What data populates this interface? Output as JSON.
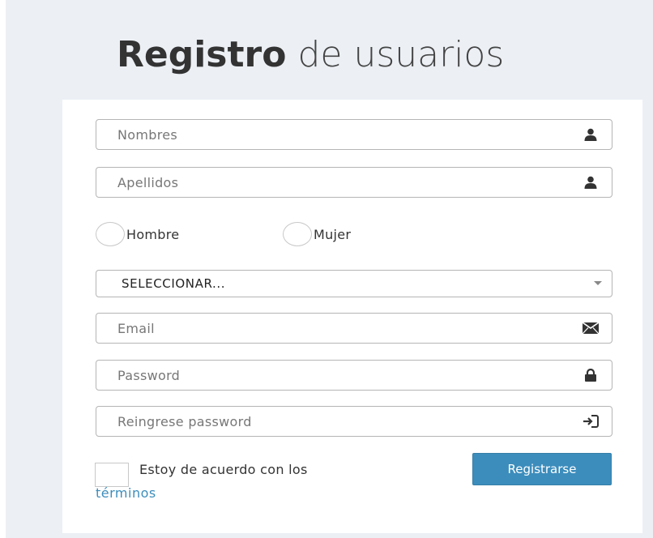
{
  "title": {
    "bold": "Registro",
    "rest": "de usuarios"
  },
  "form": {
    "nombres_placeholder": "Nombres",
    "apellidos_placeholder": "Apellidos",
    "gender_options": [
      "Hombre",
      "Mujer"
    ],
    "select_value": "SELECCIONAR...",
    "email_placeholder": "Email",
    "password_placeholder": "Password",
    "repassword_placeholder": "Reingrese password",
    "agree_text": "Estoy de acuerdo con los",
    "terms_link": "términos",
    "submit_label": "Registrarse"
  },
  "icons": {
    "nombres": "user-icon",
    "apellidos": "user-icon",
    "email": "envelope-icon",
    "password": "lock-icon",
    "repassword": "log-in-icon"
  },
  "colors": {
    "accent": "#3c8dbc",
    "background": "#ecf0f5"
  }
}
